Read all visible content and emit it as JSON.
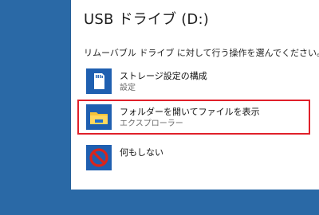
{
  "dialog": {
    "title": "USB ドライブ (D:)",
    "instruction": "リムーバブル ドライブ に対して行う操作を選んでください。",
    "options": [
      {
        "label": "ストレージ設定の構成",
        "sublabel": "設定",
        "icon": "sd-card-icon",
        "highlighted": false
      },
      {
        "label": "フォルダーを開いてファイルを表示",
        "sublabel": "エクスプローラー",
        "icon": "folder-icon",
        "highlighted": true
      },
      {
        "label": "何もしない",
        "sublabel": "",
        "icon": "no-action-icon",
        "highlighted": false
      }
    ]
  },
  "colors": {
    "desktop": "#2a69a6",
    "icon_tile": "#1f5fb0",
    "highlight_border": "#e0202a",
    "folder": "#f5c33b"
  }
}
